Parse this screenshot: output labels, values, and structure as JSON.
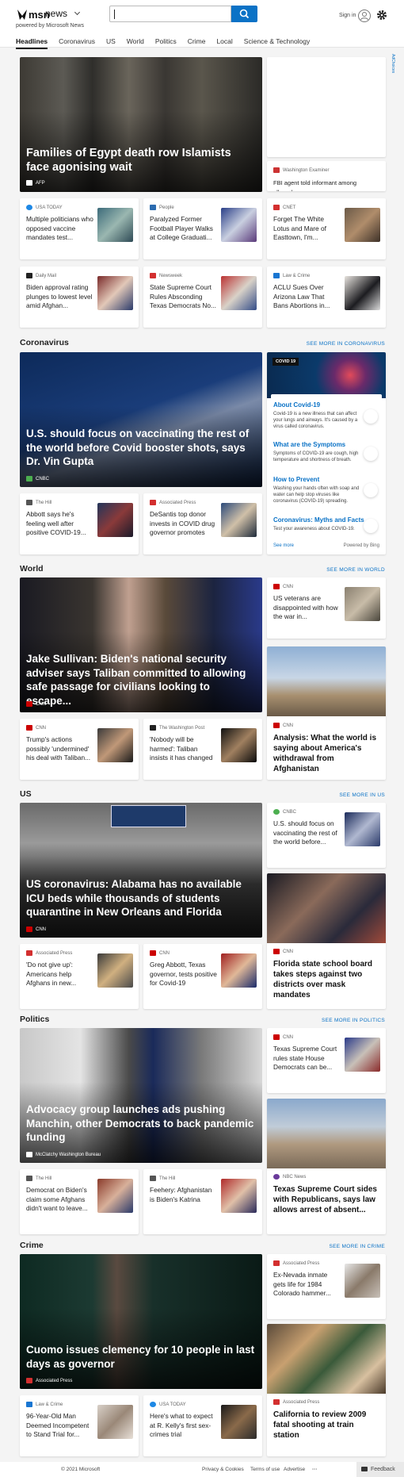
{
  "header": {
    "brand": "msn",
    "section": "news",
    "powered": "powered by Microsoft News",
    "signin": "Sign in",
    "search_value": ""
  },
  "nav": [
    "Headlines",
    "Coronavirus",
    "US",
    "World",
    "Politics",
    "Crime",
    "Local",
    "Science & Technology"
  ],
  "side_ad": "AdChoices",
  "top": {
    "hero": {
      "title": "Families of Egypt death row Islamists face agonising wait",
      "source": "AFP"
    },
    "right_top": {
      "source": "Washington Examiner",
      "title": "FBI agent told informant among alleged..."
    },
    "row1": [
      {
        "source": "USA TODAY",
        "title": "Multiple politicians who opposed vaccine mandates test..."
      },
      {
        "source": "People",
        "title": "Paralyzed Former Football Player Walks at College Graduati..."
      },
      {
        "source": "CNET",
        "title": "Forget The White Lotus and Mare of Easttown, I'm..."
      }
    ],
    "row2": [
      {
        "source": "Daily Mail",
        "title": "Biden approval rating plunges to lowest level amid Afghan..."
      },
      {
        "source": "Newsweek",
        "title": "State Supreme Court Rules Absconding Texas Democrats No..."
      },
      {
        "source": "Law & Crime",
        "title": "ACLU Sues Over Arizona Law That Bans Abortions in..."
      }
    ]
  },
  "coronavirus": {
    "heading": "Coronavirus",
    "more": "SEE MORE IN CORONAVIRUS",
    "hero": {
      "title": "U.S. should focus on vaccinating the rest of the world before Covid booster shots, says Dr. Vin Gupta",
      "source": "CNBC"
    },
    "row": [
      {
        "source": "The Hill",
        "title": "Abbott says he's feeling well after positive COVID-19..."
      },
      {
        "source": "Associated Press",
        "title": "DeSantis top donor invests in COVID drug governor promotes"
      }
    ],
    "info": {
      "badge": "COVID 19",
      "items": [
        {
          "h": "About Covid-19",
          "d": "Covid-19 is a new illness that can affect your lungs and airways. It's caused by a virus called coronavirus."
        },
        {
          "h": "What are the Symptoms",
          "d": "Symptoms of COVID-19 are cough, high temperature and shortness of breath."
        },
        {
          "h": "How to Prevent",
          "d": "Washing your hands often with soap and water can help stop viruses like coronavirus (COVID-19) spreading."
        },
        {
          "h": "Coronavirus: Myths and Facts",
          "d": "Test your awareness about COVID-19."
        }
      ],
      "see_more": "See more",
      "powered": "Powered by Bing"
    }
  },
  "world": {
    "heading": "World",
    "more": "SEE MORE IN WORLD",
    "hero": {
      "title": "Jake Sullivan: Biden's national security adviser says Taliban committed to allowing safe passage for civilians looking to escape...",
      "source": "CNN"
    },
    "right_small": {
      "source": "CNN",
      "title": "US veterans are disappointed with how the war in..."
    },
    "row": [
      {
        "source": "CNN",
        "title": "Trump's actions possibly 'undermined' his deal with Taliban..."
      },
      {
        "source": "The Washington Post",
        "title": "'Nobody will be harmed': Taliban insists it has changed"
      }
    ],
    "right_big": {
      "source": "CNN",
      "title": "Analysis: What the world is saying about America's withdrawal from Afghanistan"
    }
  },
  "us": {
    "heading": "US",
    "more": "SEE MORE IN US",
    "hero": {
      "title": "US coronavirus: Alabama has no available ICU beds while thousands of students quarantine in New Orleans and Florida",
      "source": "CNN"
    },
    "right_small": {
      "source": "CNBC",
      "title": "U.S. should focus on vaccinating the rest of the world before..."
    },
    "row": [
      {
        "source": "Associated Press",
        "title": "'Do not give up': Americans help Afghans in new..."
      },
      {
        "source": "CNN",
        "title": "Greg Abbott, Texas governor, tests positive for Covid-19"
      }
    ],
    "right_big": {
      "source": "CNN",
      "title": "Florida state school board takes steps against two districts over mask mandates"
    }
  },
  "politics": {
    "heading": "Politics",
    "more": "SEE MORE IN POLITICS",
    "hero": {
      "title": "Advocacy group launches ads pushing Manchin, other Democrats to back pandemic funding",
      "source": "McClatchy Washington Bureau"
    },
    "right_small": {
      "source": "CNN",
      "title": "Texas Supreme Court rules state House Democrats can be..."
    },
    "row": [
      {
        "source": "The Hill",
        "title": "Democrat on Biden's claim some Afghans didn't want to leave..."
      },
      {
        "source": "The Hill",
        "title": "Feehery: Afghanistan is Biden's Katrina"
      }
    ],
    "right_big": {
      "source": "NBC News",
      "title": "Texas Supreme Court sides with Republicans, says law allows arrest of absent..."
    }
  },
  "crime": {
    "heading": "Crime",
    "more": "SEE MORE IN CRIME",
    "hero": {
      "title": "Cuomo issues clemency for 10 people in last days as governor",
      "source": "Associated Press"
    },
    "right_small": {
      "source": "Associated Press",
      "title": "Ex-Nevada inmate gets life for 1984 Colorado hammer..."
    },
    "row": [
      {
        "source": "Law & Crime",
        "title": "96-Year-Old Man Deemed Incompetent to Stand Trial for..."
      },
      {
        "source": "USA TODAY",
        "title": "Here's what to expect at R. Kelly's first sex-crimes trial"
      }
    ],
    "right_big": {
      "source": "Associated Press",
      "title": "California to review 2009 fatal shooting at train station"
    }
  },
  "footer": {
    "copyright": "© 2021 Microsoft",
    "privacy": "Privacy & Cookies",
    "terms": "Terms of use",
    "advertise": "Advertise",
    "more": "···",
    "feedback": "Feedback"
  }
}
